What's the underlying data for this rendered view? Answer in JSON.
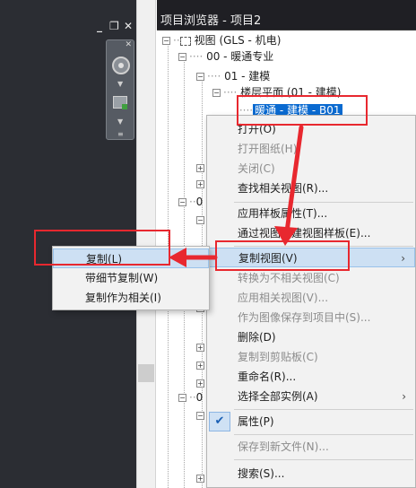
{
  "viewport_controls": {
    "minimize": "_",
    "restore": "❐",
    "close": "✕"
  },
  "browser": {
    "title": "项目浏览器 - 项目2",
    "tree": {
      "root": "视图 (GLS - 机电)",
      "discipline": "00 - 暖通专业",
      "sub_discipline": "01 - 建模",
      "view_type": "楼层平面 (01 - 建模)",
      "selected_view": "暖通 - 建模 - B01",
      "partial_labels": [
        "0",
        "0"
      ]
    }
  },
  "context_menu": {
    "items": [
      {
        "label": "打开(O)",
        "enabled": true
      },
      {
        "label": "打开图纸(H)",
        "enabled": false
      },
      {
        "label": "关闭(C)",
        "enabled": false
      },
      {
        "label": "查找相关视图(R)...",
        "enabled": true
      },
      {
        "label": "应用样板属性(T)...",
        "enabled": true
      },
      {
        "label": "通过视图创建视图样板(E)...",
        "enabled": true
      },
      {
        "label": "复制视图(V)",
        "enabled": true,
        "submenu": true,
        "highlighted": true
      },
      {
        "label": "转换为不相关视图(C)",
        "enabled": false
      },
      {
        "label": "应用相关视图(V)...",
        "enabled": false
      },
      {
        "label": "作为图像保存到项目中(S)...",
        "enabled": false
      },
      {
        "label": "删除(D)",
        "enabled": true
      },
      {
        "label": "复制到剪贴板(C)",
        "enabled": false
      },
      {
        "label": "重命名(R)...",
        "enabled": true
      },
      {
        "label": "选择全部实例(A)",
        "enabled": true,
        "submenu": true
      },
      {
        "label": "属性(P)",
        "enabled": true,
        "checked": true
      },
      {
        "label": "保存到新文件(N)...",
        "enabled": false
      },
      {
        "label": "搜索(S)...",
        "enabled": true
      }
    ],
    "submenu_arrow": "›",
    "check_mark": "✔"
  },
  "sub_menu": {
    "items": [
      {
        "label": "复制(L)",
        "highlighted": true
      },
      {
        "label": "带细节复制(W)"
      },
      {
        "label": "复制作为相关(I)"
      }
    ]
  },
  "colors": {
    "selection": "#0a6ad0",
    "highlight": "#cde0f3",
    "annotation_red": "#e8282f",
    "title_bar": "#1f1f24"
  }
}
